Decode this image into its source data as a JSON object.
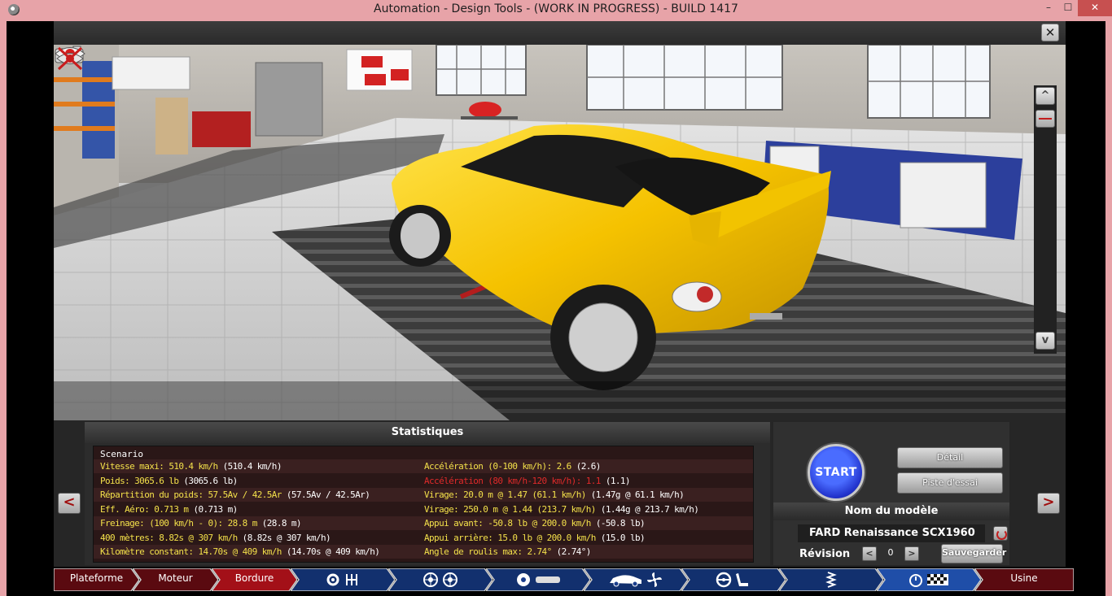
{
  "window": {
    "title": "Automation - Design Tools - (WORK IN PROGRESS) - BUILD 1417",
    "minimize": "–",
    "maximize": "☐",
    "close": "✕"
  },
  "viewport": {
    "close_label": "✕",
    "scroll_up": "^",
    "scroll_down": "v"
  },
  "stats": {
    "title": "Statistiques",
    "scenario": "Scenario",
    "left": [
      {
        "value": "Vitesse maxi: 510.4 km/h",
        "compare": "(510.4 km/h)",
        "highlight": false
      },
      {
        "value": "Poids: 3065.6 lb",
        "compare": "(3065.6 lb)",
        "highlight": false
      },
      {
        "value": "Répartition du poids: 57.5Av / 42.5Ar",
        "compare": "(57.5Av / 42.5Ar)",
        "highlight": false
      },
      {
        "value": "Eff. Aéro: 0.713 m",
        "compare": " (0.713 m)",
        "highlight": false
      },
      {
        "value": "Freinage: (100 km/h - 0): 28.8 m",
        "compare": " (28.8 m)",
        "highlight": false
      },
      {
        "value": "400 mètres: 8.82s @ 307 km/h",
        "compare": "(8.82s @ 307 km/h)",
        "highlight": false
      },
      {
        "value": "Kilomètre constant: 14.70s @ 409 km/h",
        "compare": "(14.70s @ 409 km/h)",
        "highlight": false
      }
    ],
    "right": [
      {
        "value": "Accélération (0-100 km/h): 2.6",
        "compare": "(2.6)",
        "highlight": false
      },
      {
        "value": "Accélération (80 km/h-120 km/h): 1.1",
        "compare": "(1.1)",
        "highlight": true
      },
      {
        "value": "Virage: 20.0 m @ 1.47 (61.1 km/h)",
        "compare": "(1.47g @ 61.1 km/h)",
        "highlight": false
      },
      {
        "value": "Virage: 250.0 m @ 1.44 (213.7 km/h)",
        "compare": "(1.44g @ 213.7 km/h)",
        "highlight": false
      },
      {
        "value": "Appui avant: -50.8 lb @ 200.0 km/h",
        "compare": "(-50.8 lb)",
        "highlight": false
      },
      {
        "value": "Appui arrière: 15.0 lb @ 200.0 km/h",
        "compare": "(15.0 lb)",
        "highlight": false
      },
      {
        "value": "Angle de roulis max: 2.74°",
        "compare": "(2.74°)",
        "highlight": false
      }
    ]
  },
  "controls": {
    "prev": "<",
    "next": ">",
    "start": "START",
    "detail": "Détail",
    "test_track": "Piste d'essai",
    "model_header": "Nom du modèle",
    "model_name": "FARD Renaissance  SCX1960",
    "revision_label": "Révision",
    "revision_minus": "<",
    "revision_plus": ">",
    "revision_value": "0",
    "save": "Sauvegarder"
  },
  "nav": {
    "tabs": [
      {
        "id": "plateforme",
        "label": "Plateforme",
        "active": false
      },
      {
        "id": "moteur",
        "label": "Moteur",
        "active": false
      },
      {
        "id": "bordure",
        "label": "Bordure",
        "active": true
      },
      {
        "id": "engine-gearbox",
        "label": "",
        "icons": [
          "gear-icon",
          "gearbox-icon"
        ]
      },
      {
        "id": "wheels",
        "label": "",
        "icons": [
          "wheel-icon",
          "wheel-icon"
        ]
      },
      {
        "id": "brakes",
        "label": "",
        "icons": [
          "brake-disc-icon",
          "brake-caliper-icon"
        ]
      },
      {
        "id": "body-aero",
        "label": "",
        "icons": [
          "car-body-icon",
          "fan-icon"
        ]
      },
      {
        "id": "interior",
        "label": "",
        "icons": [
          "steering-wheel-icon",
          "seat-icon"
        ]
      },
      {
        "id": "suspension",
        "label": "",
        "icons": [
          "spring-icon"
        ]
      },
      {
        "id": "testing",
        "label": "",
        "icons": [
          "stopwatch-icon",
          "checkered-flag-icon"
        ]
      },
      {
        "id": "usine",
        "label": "Usine",
        "active": false
      }
    ]
  },
  "colors": {
    "titlebar": "#e7a3a8",
    "accent_red": "#a31018",
    "stat_value": "#f3e04a",
    "stat_warning": "#e02a2a",
    "start_blue": "#2233cc"
  }
}
